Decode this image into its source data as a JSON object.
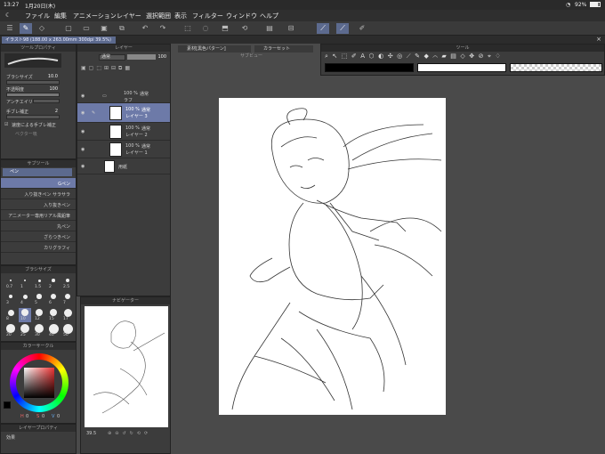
{
  "status": {
    "time": "13:27",
    "date": "1月20日(木)",
    "battery": "92%"
  },
  "menu": [
    "ファイル",
    "編集",
    "アニメーション",
    "レイヤー",
    "選択範囲",
    "表示",
    "フィルター",
    "ウィンドウ",
    "ヘルプ"
  ],
  "doc_tab": "イラスト98 (188.00 x 263.00mm 300dpi 39.5%)",
  "tool_property": {
    "title": "ツールプロパティ",
    "brush_size_label": "ブラシサイズ",
    "brush_size": "10.0",
    "opacity_label": "不透明度",
    "opacity": "100",
    "antialias_label": "アンチエイリ",
    "stabilization_label": "手ブレ補正",
    "stabilization": "2",
    "speed_label": "速度による手ブレ補正",
    "vector_label": "ベクター吸"
  },
  "subtool": {
    "title": "サブツール",
    "header": "ペン",
    "items": [
      "Gペン",
      "入り抜きペン サラサラ",
      "入り抜きペン",
      "アニメーター専用リアル風鉛筆",
      "丸ペン",
      "ざらつきペン",
      "カリグラフィ"
    ]
  },
  "brush_size": {
    "title": "ブラシサイズ",
    "sizes": [
      "0.7",
      "1",
      "1.5",
      "2",
      "2.5",
      "3",
      "4",
      "5",
      "6",
      "7",
      "8",
      "10",
      "12",
      "15",
      "17",
      "20",
      "25",
      "30",
      "40",
      "50"
    ]
  },
  "color": {
    "title": "カラーサークル",
    "h": "0",
    "s": "0",
    "v": "0"
  },
  "layer": {
    "title": "レイヤー",
    "blend": "通常",
    "opacity": "100",
    "rows": [
      {
        "pct": "100 %",
        "mode": "通常",
        "name": "ラフ"
      },
      {
        "pct": "100 %",
        "mode": "通常",
        "name": "レイヤー 3"
      },
      {
        "pct": "100 %",
        "mode": "通常",
        "name": "レイヤー 2"
      },
      {
        "pct": "100 %",
        "mode": "通常",
        "name": "レイヤー 1"
      },
      {
        "name": "用紙"
      }
    ]
  },
  "navigator": {
    "title": "ナビゲーター",
    "zoom": "39.5"
  },
  "canvas_tabs": {
    "material": "素材[黒色パターン]",
    "colorset": "カラーセット"
  },
  "sub_view": "サブビュー",
  "ref_tools": {
    "title": "ツール"
  },
  "layer_prop": {
    "title": "レイヤープロパティ",
    "label": "効果"
  },
  "colors": {
    "accent": "#6d7aa8",
    "canvas": "#ffffff",
    "bg": "#4a4a4a"
  }
}
